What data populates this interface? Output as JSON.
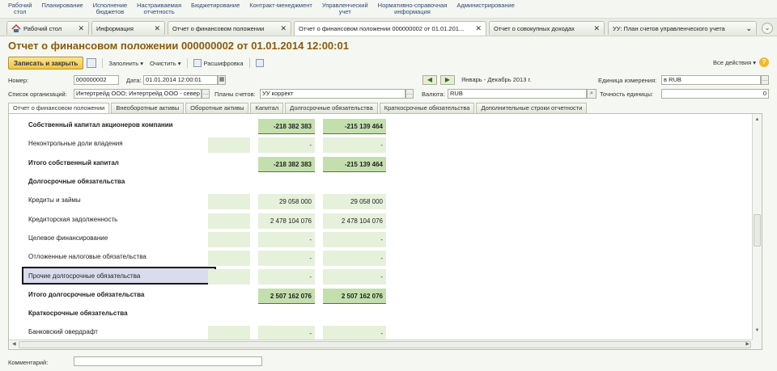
{
  "menu": [
    "Рабочий\nстол",
    "Планирование",
    "Исполнение\nбюджетов",
    "Настраиваемая\nотчетность",
    "Бюджетирование",
    "Контракт-менеджмент",
    "Управленческий\nучет",
    "Нормативно-справочная\nинформация",
    "Администрирование"
  ],
  "tabs": [
    {
      "label": "Рабочий стол",
      "close": "✕"
    },
    {
      "label": "Информация",
      "close": "✕"
    },
    {
      "label": "Отчет о финансовом положении",
      "close": "✕"
    },
    {
      "label": "Отчет о финансовом положении 000000002 от 01.01.201...",
      "close": "✕"
    },
    {
      "label": "Отчет о совокупных доходах",
      "close": "✕"
    },
    {
      "label": "УУ: План счетов управленческого учета",
      "close": "✕"
    }
  ],
  "title": "Отчет о финансовом положении 000000002 от 01.01.2014 12:00:01",
  "toolbar": {
    "save_close": "Записать и закрыть",
    "fill": "Заполнить",
    "clear": "Очистить",
    "decode": "Расшифровка",
    "all_actions": "Все действия",
    "help": "?"
  },
  "form": {
    "number_label": "Номер:",
    "number_value": "000000002",
    "date_label": "Дата:",
    "date_value": "01.01.2014 12:00:01",
    "period": "Январь - Декабрь 2013 г.",
    "unit_label": "Единица измерения:",
    "unit_value": "в RUB",
    "orgs_label": "Список организаций:",
    "orgs_value": "Интертрейд ООО; Интертрейд ООО - север",
    "plans_label": "Планы счетов:",
    "plans_value": "УУ коррект",
    "currency_label": "Валюта:",
    "currency_value": "RUB",
    "precision_label": "Точность единицы:",
    "precision_value": "0"
  },
  "report_tabs": [
    "Отчет о финансовом положении",
    "Внеоборотные активы",
    "Оборотные активы",
    "Капитал",
    "Долгосрочные обязательства",
    "Краткосрочные обязательства",
    "Дополнительные строки отчетности"
  ],
  "rows": [
    {
      "label": "Собственный капитал акционеров компании",
      "v1": "",
      "v2": "-218 382 383",
      "v3": "-215 139 464",
      "bold": true
    },
    {
      "label": "Неконтрольные доли владения",
      "v1": "",
      "v2": "-",
      "v3": "-",
      "bold": false
    },
    {
      "label": "Итого собственный капитал",
      "v1": "",
      "v2": "-218 382 383",
      "v3": "-215 139 464",
      "bold": true
    },
    {
      "label": "Долгосрочные обязательства",
      "v1": "",
      "v2": "",
      "v3": "",
      "bold": true,
      "header": true
    },
    {
      "label": "Кредиты и займы",
      "v1": "",
      "v2": "29 058 000",
      "v3": "29 058 000",
      "bold": false
    },
    {
      "label": "Кредиторская задолженность",
      "v1": "",
      "v2": "2 478 104 076",
      "v3": "2 478 104 076",
      "bold": false
    },
    {
      "label": "Целевое финансирование",
      "v1": "",
      "v2": "-",
      "v3": "-",
      "bold": false
    },
    {
      "label": "Отложенные налоговые обязательства",
      "v1": "",
      "v2": "-",
      "v3": "-",
      "bold": false
    },
    {
      "label": "Прочие долгосрочные обязательства",
      "v1": "",
      "v2": "-",
      "v3": "-",
      "bold": false,
      "selected": true
    },
    {
      "label": "Итого долгосрочные обязательства",
      "v1": "",
      "v2": "2 507 162 076",
      "v3": "2 507 162 076",
      "bold": true
    },
    {
      "label": "Краткосрочные обязательства",
      "v1": "",
      "v2": "",
      "v3": "",
      "bold": true,
      "header": true
    },
    {
      "label": "Банковский овердрафт",
      "v1": "",
      "v2": "-",
      "v3": "-",
      "bold": false
    }
  ],
  "comment_label": "Комментарий:",
  "colors": {
    "accent_title": "#8a5b08",
    "total_fill": "#c4dfae",
    "shade": "#e6f1dc",
    "primary_button": "#f2c444"
  },
  "icons": [
    "home-icon",
    "save-icon",
    "decode-icon",
    "tree-icon",
    "arrow-left-icon",
    "arrow-right-icon",
    "calendar-icon",
    "search-icon",
    "help-icon"
  ]
}
